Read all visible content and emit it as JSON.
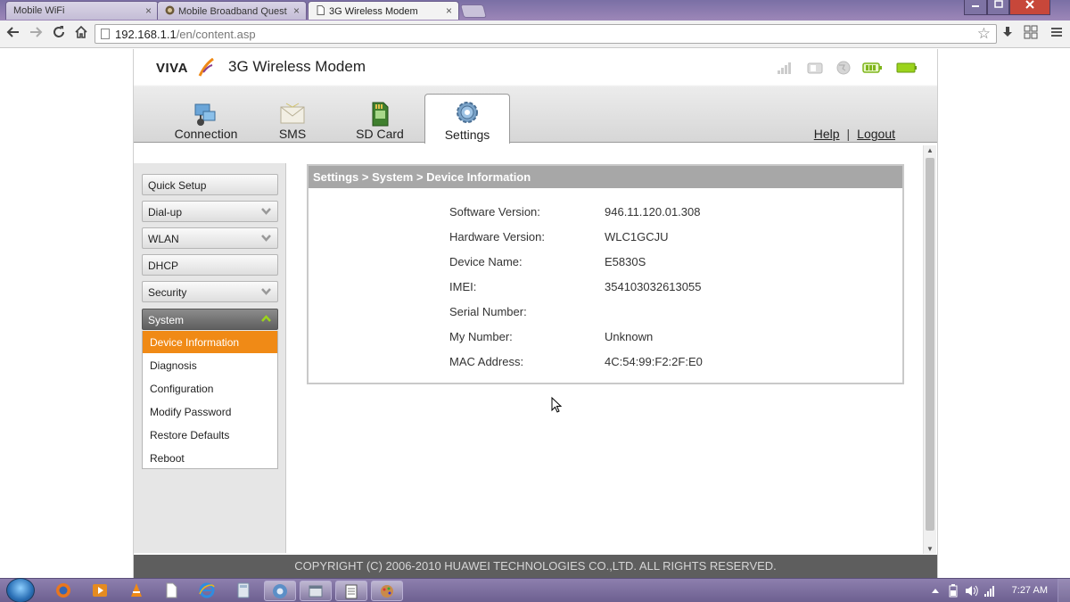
{
  "browser": {
    "tabs": [
      {
        "title": "Mobile WiFi",
        "active": false
      },
      {
        "title": "Mobile Broadband Quest",
        "active": false
      },
      {
        "title": "3G Wireless Modem",
        "active": true
      }
    ],
    "tab_close_glyph": "×",
    "url_host": "192.168.1.1",
    "url_path": "/en/content.asp"
  },
  "app": {
    "logo_text": "VIVA",
    "title": "3G Wireless Modem",
    "status_icons": [
      "signal-strength-icon",
      "sim-card-icon",
      "globe-icon",
      "battery-icon",
      "battery-full-icon"
    ],
    "tabs": [
      {
        "label": "Connection",
        "icon": "connection-icon"
      },
      {
        "label": "SMS",
        "icon": "envelope-icon"
      },
      {
        "label": "SD Card",
        "icon": "sd-card-icon"
      },
      {
        "label": "Settings",
        "icon": "gear-icon",
        "active": true
      }
    ],
    "help_label": "Help",
    "logout_label": "Logout",
    "link_separator": "|"
  },
  "sidebar": {
    "items": [
      {
        "label": "Quick Setup",
        "expandable": false
      },
      {
        "label": "Dial-up",
        "expandable": true
      },
      {
        "label": "WLAN",
        "expandable": true
      },
      {
        "label": "DHCP",
        "expandable": false
      },
      {
        "label": "Security",
        "expandable": true
      },
      {
        "label": "System",
        "expandable": true,
        "open": true
      }
    ],
    "system_subitems": [
      {
        "label": "Device Information",
        "selected": true
      },
      {
        "label": "Diagnosis"
      },
      {
        "label": "Configuration"
      },
      {
        "label": "Modify Password"
      },
      {
        "label": "Restore Defaults"
      },
      {
        "label": "Reboot"
      }
    ]
  },
  "panel": {
    "breadcrumb": "Settings > System > Device Information",
    "rows": [
      {
        "label": "Software Version:",
        "value": "946.11.120.01.308"
      },
      {
        "label": "Hardware Version:",
        "value": "WLC1GCJU"
      },
      {
        "label": "Device Name:",
        "value": "E5830S"
      },
      {
        "label": "IMEI:",
        "value": "354103032613055"
      },
      {
        "label": "Serial Number:",
        "value": ""
      },
      {
        "label": "My Number:",
        "value": "Unknown"
      },
      {
        "label": "MAC Address:",
        "value": "4C:54:99:F2:2F:E0"
      }
    ]
  },
  "footer": {
    "copyright": "COPYRIGHT (C) 2006-2010 HUAWEI TECHNOLOGIES CO.,LTD. ALL RIGHTS RESERVED."
  },
  "taskbar": {
    "clock": "7:27 AM"
  },
  "colors": {
    "accent_orange": "#f08a16",
    "panel_header": "#a7a7a7",
    "footer_bg": "#5e5e5e"
  }
}
